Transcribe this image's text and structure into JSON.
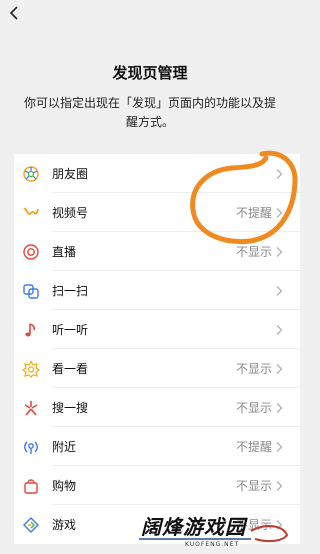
{
  "header": {
    "title": "发现页管理",
    "description": "你可以指定出现在「发现」页面内的功能以及提醒方式。"
  },
  "items": [
    {
      "label": "朋友圈",
      "status": "",
      "icon": "moments-icon",
      "color": "#f0a020"
    },
    {
      "label": "视频号",
      "status": "不提醒",
      "icon": "channels-icon",
      "color": "#f0a020"
    },
    {
      "label": "直播",
      "status": "不显示",
      "icon": "live-icon",
      "color": "#e8453c"
    },
    {
      "label": "扫一扫",
      "status": "",
      "icon": "scan-icon",
      "color": "#3b7be8"
    },
    {
      "label": "听一听",
      "status": "",
      "icon": "listen-icon",
      "color": "#e8453c"
    },
    {
      "label": "看一看",
      "status": "不显示",
      "icon": "top-stories-icon",
      "color": "#f0b020"
    },
    {
      "label": "搜一搜",
      "status": "不显示",
      "icon": "search-icon",
      "color": "#e8453c"
    },
    {
      "label": "附近",
      "status": "不提醒",
      "icon": "nearby-icon",
      "color": "#3b7be8"
    },
    {
      "label": "购物",
      "status": "不显示",
      "icon": "shopping-icon",
      "color": "#e8453c"
    },
    {
      "label": "游戏",
      "status": "不显示",
      "icon": "games-icon",
      "color": "#3b7be8"
    }
  ],
  "watermark": {
    "text": "阔烽游戏园",
    "subtext": "KUOFENG.NET"
  },
  "colors": {
    "background": "#f0f0f0",
    "annotation": "#f08a20"
  }
}
